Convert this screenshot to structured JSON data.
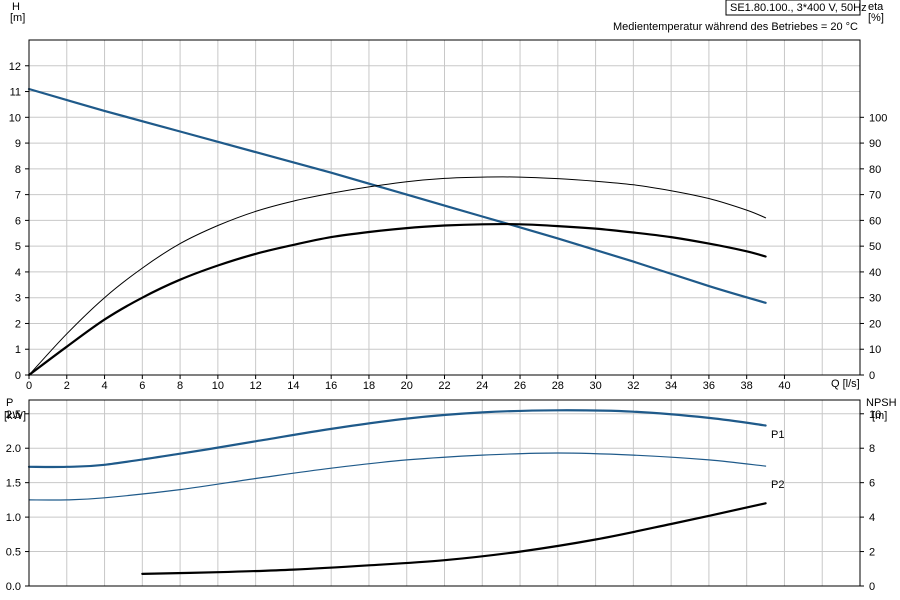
{
  "colors": {
    "blue": "#1f5a8a",
    "black": "#000000",
    "grid": "#c8c8c8"
  },
  "chart_data": [
    {
      "type": "line",
      "panel": "top",
      "title": "SE1.80.100., 3*400 V, 50Hz",
      "subtitle": "Medientemperatur während des Betriebes = 20 °C",
      "xlabel": "Q [l/s]",
      "ylabel_left": "H",
      "ylabel_left_unit": "[m]",
      "ylabel_right": "eta",
      "ylabel_right_unit": "[%]",
      "xlim": [
        0,
        44
      ],
      "ylim_left": [
        0,
        13
      ],
      "ylim_right": [
        0,
        130
      ],
      "x_ticks": [
        "0",
        "2",
        "4",
        "6",
        "8",
        "10",
        "12",
        "14",
        "16",
        "18",
        "20",
        "22",
        "24",
        "26",
        "28",
        "30",
        "32",
        "34",
        "36",
        "38",
        "40"
      ],
      "y_ticks_left": [
        "0",
        "1",
        "2",
        "3",
        "4",
        "5",
        "6",
        "7",
        "8",
        "9",
        "10",
        "11",
        "12"
      ],
      "y_ticks_right": [
        "0",
        "10",
        "20",
        "30",
        "40",
        "50",
        "60",
        "70",
        "80",
        "90",
        "100"
      ],
      "grid": true,
      "series": [
        {
          "axis": "left",
          "color": "#1f5a8a",
          "width": 2.2,
          "x": [
            0,
            4,
            8,
            12,
            16,
            20,
            24,
            28,
            32,
            36,
            39
          ],
          "y": [
            11.1,
            10.25,
            9.45,
            8.65,
            7.85,
            7.0,
            6.15,
            5.3,
            4.4,
            3.45,
            2.8
          ]
        },
        {
          "axis": "right",
          "color": "#000000",
          "width": 1,
          "x": [
            0,
            2,
            4,
            6,
            8,
            10,
            12,
            14,
            16,
            18,
            20,
            22,
            24,
            26,
            28,
            30,
            32,
            34,
            36,
            38,
            39
          ],
          "y": [
            0,
            16,
            30,
            41.5,
            51,
            58,
            63.5,
            67.5,
            70.5,
            73,
            75,
            76.3,
            76.8,
            76.8,
            76.2,
            75.2,
            73.8,
            71.5,
            68.5,
            64,
            61
          ]
        },
        {
          "axis": "right",
          "color": "#000000",
          "width": 2.2,
          "x": [
            0,
            2,
            4,
            6,
            8,
            10,
            12,
            14,
            16,
            18,
            20,
            22,
            24,
            26,
            28,
            30,
            32,
            34,
            36,
            38,
            39
          ],
          "y": [
            0,
            11,
            21.5,
            30,
            37,
            42.5,
            47,
            50.5,
            53.5,
            55.5,
            57,
            58,
            58.5,
            58.5,
            57.8,
            56.8,
            55.3,
            53.5,
            51,
            48,
            46
          ]
        }
      ]
    },
    {
      "type": "line",
      "panel": "bottom",
      "xlim": [
        0,
        44
      ],
      "ylabel_left": "P",
      "ylabel_left_unit": "[kW]",
      "ylabel_right": "NPSH",
      "ylabel_right_unit": "[m]",
      "ylim_left": [
        0,
        2.7
      ],
      "ylim_right": [
        0,
        10.8
      ],
      "y_ticks_left": [
        "0.0",
        "0.5",
        "1.0",
        "1.5",
        "2.0",
        "2.5"
      ],
      "y_ticks_right": [
        "0",
        "2",
        "4",
        "6",
        "8",
        "10"
      ],
      "grid": true,
      "series": [
        {
          "name": "P1",
          "axis": "left",
          "color": "#1f5a8a",
          "width": 2.2,
          "x": [
            0,
            2,
            4,
            8,
            12,
            16,
            20,
            24,
            28,
            32,
            36,
            39
          ],
          "y": [
            1.73,
            1.73,
            1.76,
            1.92,
            2.1,
            2.28,
            2.43,
            2.52,
            2.55,
            2.53,
            2.44,
            2.33
          ]
        },
        {
          "name": "P2",
          "axis": "left",
          "color": "#1f5a8a",
          "width": 1.2,
          "x": [
            0,
            2,
            4,
            8,
            12,
            16,
            20,
            24,
            28,
            32,
            36,
            39
          ],
          "y": [
            1.25,
            1.25,
            1.28,
            1.4,
            1.56,
            1.71,
            1.83,
            1.9,
            1.93,
            1.9,
            1.83,
            1.74
          ]
        },
        {
          "axis": "right",
          "color": "#000000",
          "width": 2.2,
          "x": [
            6,
            10,
            14,
            18,
            22,
            26,
            30,
            34,
            39
          ],
          "y": [
            0.7,
            0.8,
            0.95,
            1.2,
            1.5,
            2.0,
            2.7,
            3.6,
            4.8
          ]
        }
      ]
    }
  ]
}
